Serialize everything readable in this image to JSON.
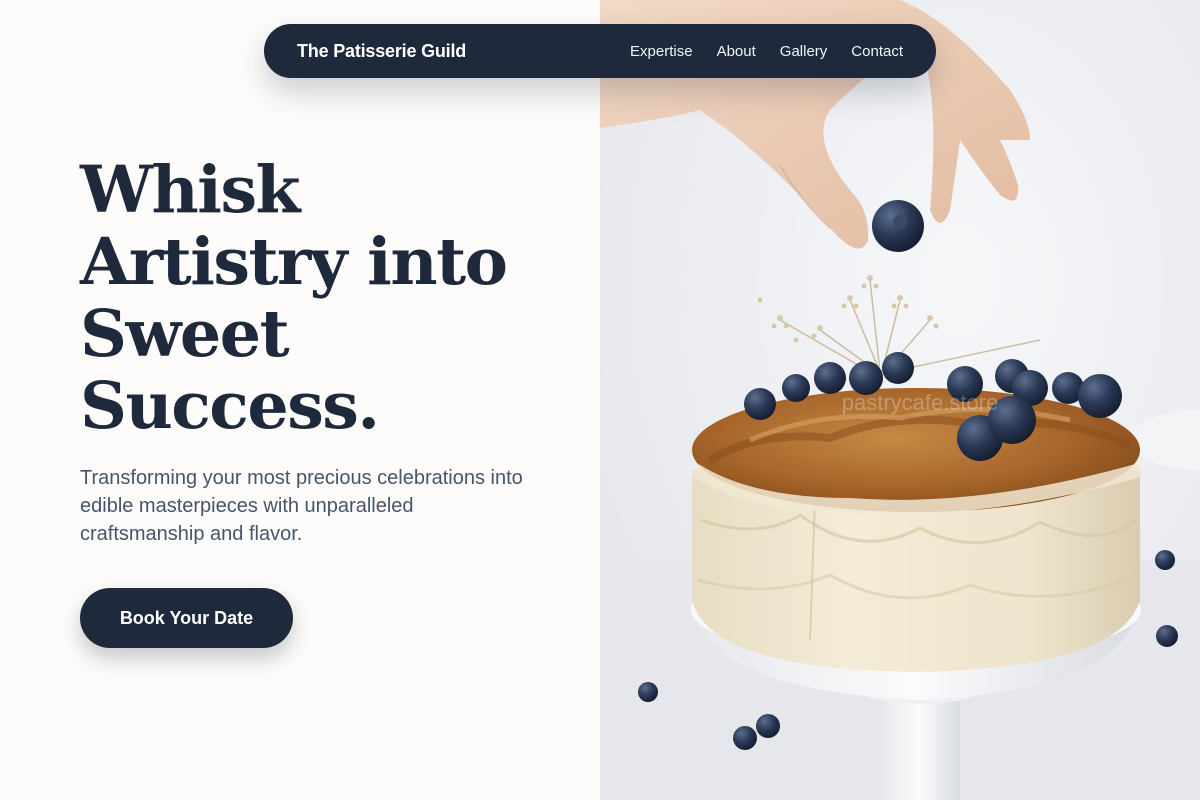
{
  "nav": {
    "brand": "The Patisserie Guild",
    "links": [
      "Expertise",
      "About",
      "Gallery",
      "Contact"
    ]
  },
  "hero": {
    "title_lines": [
      "Whisk",
      "Artistry into",
      "Sweet",
      "Success."
    ],
    "subtitle": "Transforming your most precious celebrations into edible masterpieces with unparalleled craftsmanship and flavor.",
    "cta_label": "Book Your Date"
  },
  "image": {
    "subject": "hero-cake-photo",
    "watermark": "pastrycafe.store"
  },
  "colors": {
    "navy": "#1e293b",
    "body_text": "#475569",
    "background": "#fdfcfa",
    "white": "#ffffff"
  }
}
